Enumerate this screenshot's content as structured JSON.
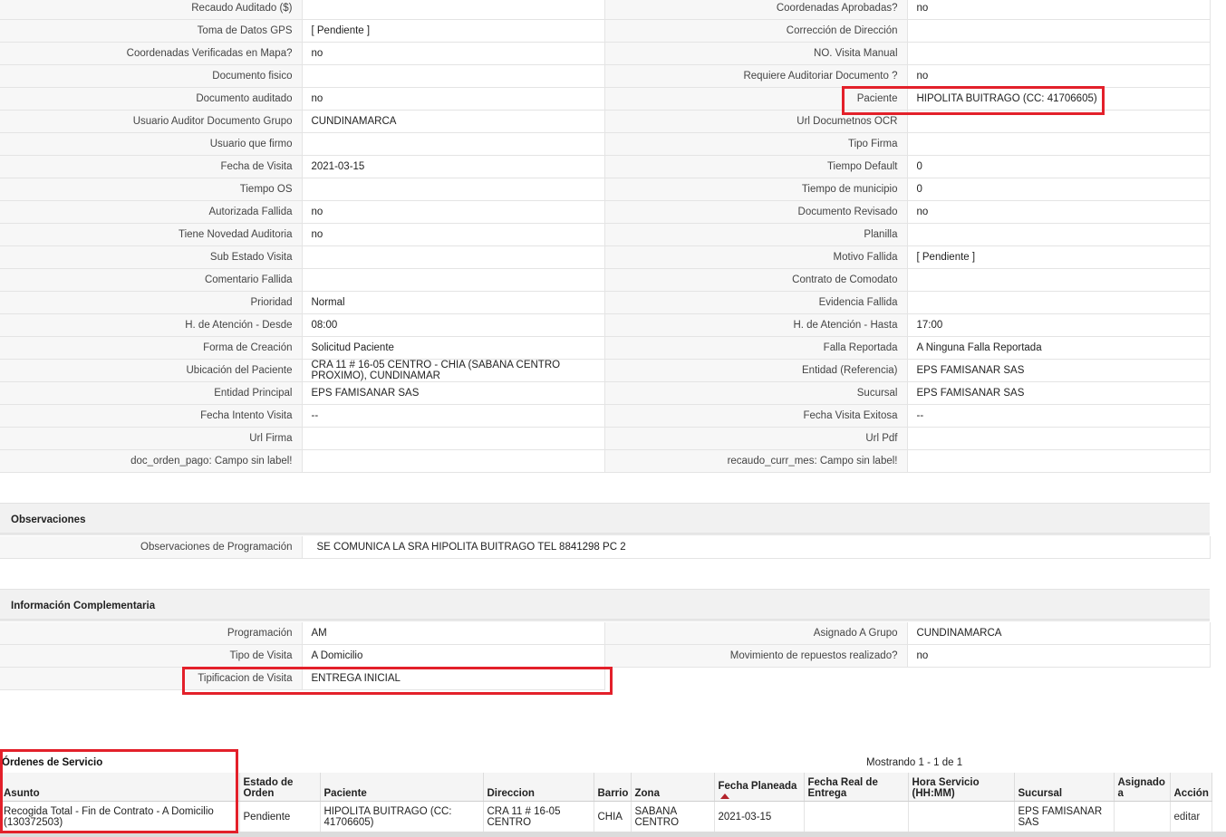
{
  "details": [
    [
      "Recaudo Auditado ($)",
      "",
      "Coordenadas Aprobadas?",
      "no"
    ],
    [
      "Toma de Datos GPS",
      "[ Pendiente ]",
      "Corrección de Dirección",
      ""
    ],
    [
      "Coordenadas Verificadas en Mapa?",
      "no",
      "NO. Visita Manual",
      ""
    ],
    [
      "Documento fisico",
      "",
      "Requiere Auditoriar Documento ?",
      "no"
    ],
    [
      "Documento auditado",
      "no",
      "Paciente",
      "HIPOLITA BUITRAGO (CC: 41706605)"
    ],
    [
      "Usuario Auditor Documento Grupo",
      "CUNDINAMARCA",
      "Url Documetnos OCR",
      ""
    ],
    [
      "Usuario que firmo",
      "",
      "Tipo Firma",
      ""
    ],
    [
      "Fecha de Visita",
      "2021-03-15",
      "Tiempo Default",
      "0"
    ],
    [
      "Tiempo OS",
      "",
      "Tiempo de municipio",
      "0"
    ],
    [
      "Autorizada Fallida",
      "no",
      "Documento Revisado",
      "no"
    ],
    [
      "Tiene Novedad Auditoria",
      "no",
      "Planilla",
      ""
    ],
    [
      "Sub Estado Visita",
      "",
      "Motivo Fallida",
      "[ Pendiente ]"
    ],
    [
      "Comentario Fallida",
      "",
      "Contrato de Comodato",
      ""
    ],
    [
      "Prioridad",
      "Normal",
      "Evidencia Fallida",
      ""
    ],
    [
      "H. de Atención - Desde",
      "08:00",
      "H. de Atención - Hasta",
      "17:00"
    ],
    [
      "Forma de Creación",
      "Solicitud Paciente",
      "Falla Reportada",
      "A Ninguna Falla Reportada"
    ],
    [
      "Ubicación del Paciente",
      "CRA 11 # 16-05 CENTRO - CHIA (SABANA CENTRO PROXIMO), CUNDINAMAR",
      "Entidad (Referencia)",
      "EPS FAMISANAR SAS"
    ],
    [
      "Entidad Principal",
      "EPS FAMISANAR SAS",
      "Sucursal",
      "EPS FAMISANAR SAS"
    ],
    [
      "Fecha Intento Visita",
      "--",
      "Fecha Visita Exitosa",
      "--"
    ],
    [
      "Url Firma",
      "",
      "Url Pdf",
      ""
    ],
    [
      "doc_orden_pago: Campo sin label!",
      "",
      "recaudo_curr_mes: Campo sin label!",
      ""
    ]
  ],
  "observaciones": {
    "title": "Observaciones",
    "label": "Observaciones de Programación",
    "value": "SE COMUNICA LA SRA HIPOLITA BUITRAGO TEL 8841298 PC 2"
  },
  "complementaria": {
    "title": "Información Complementaria",
    "rows": [
      [
        "Programación",
        "AM",
        "Asignado A Grupo",
        "CUNDINAMARCA"
      ],
      [
        "Tipo de Visita",
        "A Domicilio",
        "Movimiento de repuestos realizado?",
        "no"
      ]
    ],
    "tipificacion_label": "Tipificacion de Visita",
    "tipificacion_value": "ENTREGA INICIAL"
  },
  "ordenes": {
    "title": "Órdenes de Servicio",
    "showing": "Mostrando 1 - 1 de 1",
    "columns": [
      "Asunto",
      "Estado de Orden",
      "Paciente",
      "Direccion",
      "Barrio",
      "Zona",
      "Fecha Planeada",
      "Fecha Real de Entrega",
      "Hora Servicio (HH:MM)",
      "Sucursal",
      "Asignado a",
      "Acción"
    ],
    "rows": [
      [
        "Recogida Total - Fin de Contrato - A Domicilio (130372503)",
        "Pendiente",
        "HIPOLITA BUITRAGO (CC: 41706605)",
        "CRA 11 # 16-05 CENTRO",
        "CHIA",
        "SABANA CENTRO",
        "2021-03-15",
        "",
        "",
        "EPS FAMISANAR SAS",
        "",
        "editar"
      ]
    ]
  },
  "highlight_color": "#e3202a"
}
